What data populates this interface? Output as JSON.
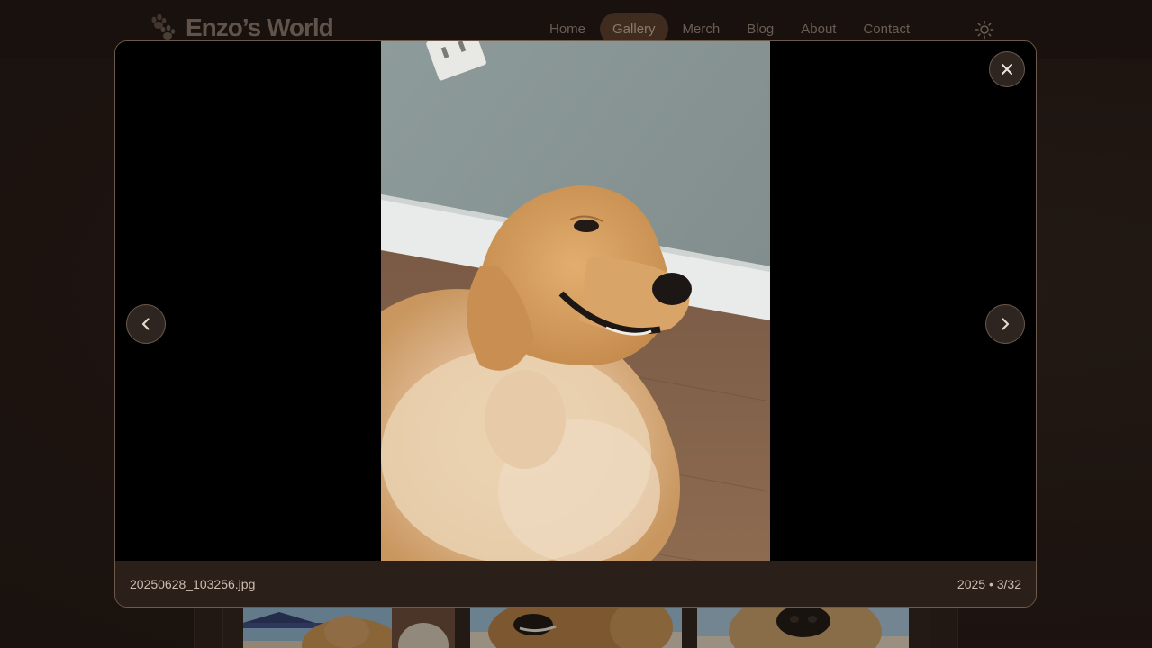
{
  "brand": {
    "name": "Enzo’s World",
    "logo_icon": "paw-icon"
  },
  "nav": {
    "items": [
      {
        "label": "Home"
      },
      {
        "label": "Gallery",
        "active": true
      },
      {
        "label": "Merch"
      },
      {
        "label": "Blog"
      },
      {
        "label": "About"
      },
      {
        "label": "Contact"
      }
    ],
    "theme_toggle_icon": "sun-icon"
  },
  "lightbox": {
    "filename": "20250628_103256.jpg",
    "counter": "2025 • 3/32",
    "prev_icon": "chevron-left-icon",
    "next_icon": "chevron-right-icon",
    "close_icon": "close-icon"
  },
  "colors": {
    "background": "#241a15",
    "header": "#1c1410",
    "accent_active_nav": "#5a3d2c",
    "modal_border": "#6e5a4d",
    "text": "#cdbdb0"
  }
}
